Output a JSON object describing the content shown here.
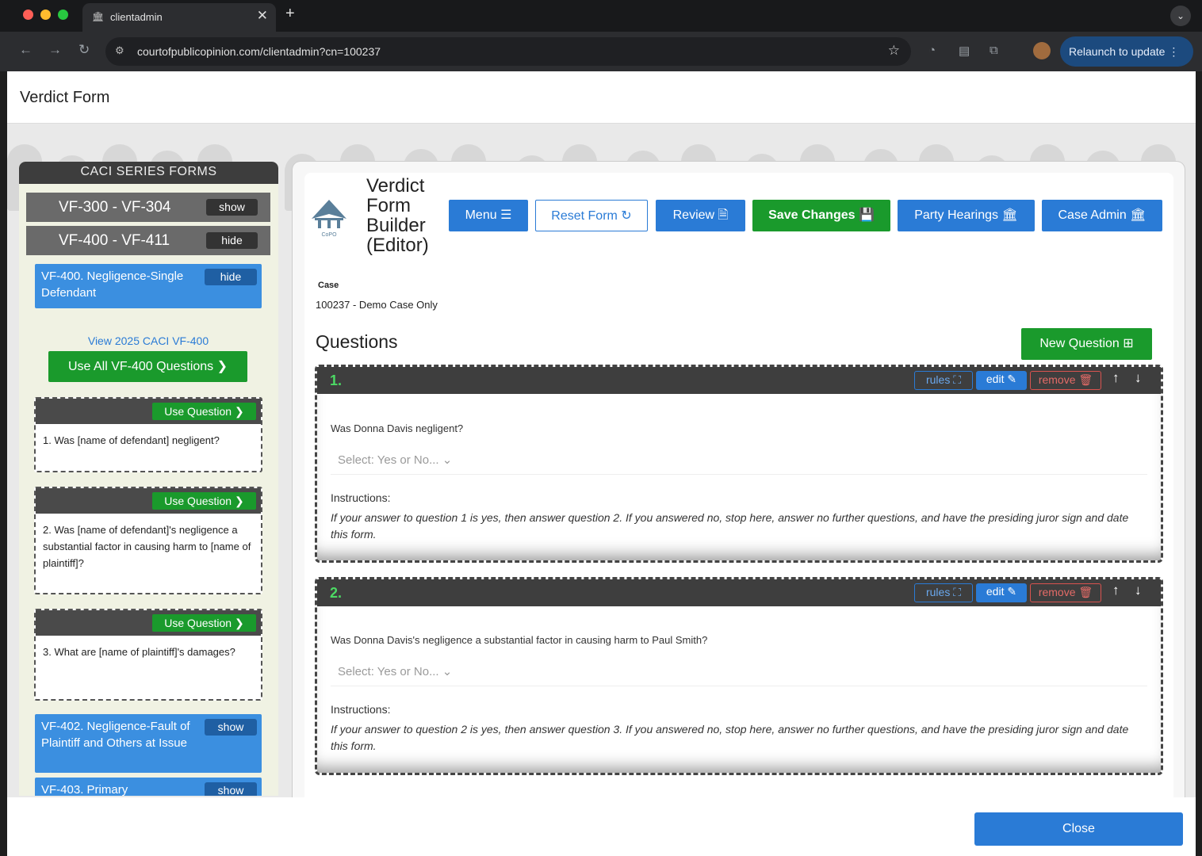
{
  "browser": {
    "tab_title": "clientadmin",
    "tab_close": "✕",
    "new_tab": "+",
    "url": "courtofpublicopinion.com/clientadmin?cn=100237",
    "relaunch_label": "Relaunch to update"
  },
  "page": {
    "title": "Verdict Form"
  },
  "sidebar": {
    "title": "CACI SERIES FORMS",
    "groups": [
      {
        "label": "VF-300 - VF-304",
        "toggle": "show"
      },
      {
        "label": "VF-400 - VF-411",
        "toggle": "hide"
      }
    ],
    "forms": [
      {
        "label": "VF-400. Negligence-Single Defendant",
        "toggle": "hide"
      },
      {
        "label": "VF-402. Negligence-Fault of Plaintiff and Others at Issue",
        "toggle": "show"
      },
      {
        "label": "VF-403. Primary",
        "toggle": "show"
      }
    ],
    "view_link": "View 2025 CACI VF-400",
    "use_all": "Use All VF-400 Questions ❯",
    "use_question": "Use Question ❯",
    "questions": [
      "1. Was [name of defendant] negligent?",
      "2. Was [name of defendant]'s negligence a substantial factor in causing harm to [name of plaintiff]?",
      "3. What are [name of plaintiff]'s damages?"
    ]
  },
  "builder": {
    "title": "Verdict Form Builder (Editor)",
    "logo_text": "CoPO",
    "buttons": {
      "menu": "Menu ☰",
      "reset": "Reset Form ↻",
      "review": "Review 🗎",
      "save": "Save Changes 💾",
      "party": "Party Hearings 🏛",
      "case_admin": "Case Admin 🏛"
    },
    "case_label": "Case",
    "case_value": "100237 - Demo Case Only",
    "questions_heading": "Questions",
    "new_question": "New Question ⊞",
    "actions": {
      "rules": "rules ⛶",
      "edit": "edit ✎",
      "remove": "remove 🗑",
      "up": "↑",
      "down": "↓"
    },
    "select_placeholder": "Select: Yes or No... ⌄",
    "instructions_label": "Instructions:",
    "items": [
      {
        "num": "1.",
        "text": "Was Donna Davis negligent?",
        "instructions": "If your answer to question 1 is yes, then answer question 2. If you answered no, stop here, answer no further questions, and have the presiding juror sign and date this form."
      },
      {
        "num": "2.",
        "text": "Was Donna Davis's negligence a substantial factor in causing harm to Paul Smith?",
        "instructions": "If your answer to question 2 is yes, then answer question 3. If you answered no, stop here, answer no further questions, and have the presiding juror sign and date this form."
      }
    ]
  },
  "footer": {
    "close": "Close"
  }
}
